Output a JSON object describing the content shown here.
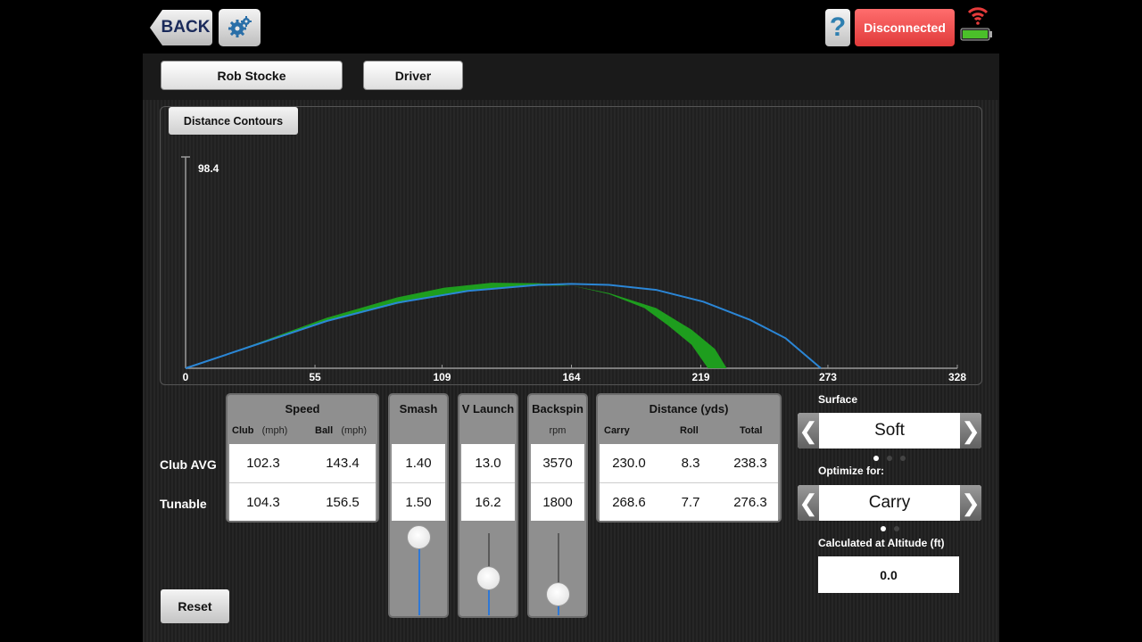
{
  "topbar": {
    "back_label": "BACK",
    "help_label": "?",
    "status_label": "Disconnected",
    "status_color": "#e84444"
  },
  "selectors": {
    "player": "Rob Stocke",
    "club": "Driver"
  },
  "chart": {
    "toggle_label": "Distance Contours",
    "y_max_label": "98.4"
  },
  "chart_data": {
    "type": "line",
    "title": "",
    "xlabel": "",
    "ylabel": "",
    "x_ticks": [
      "0",
      "55",
      "109",
      "164",
      "219",
      "273",
      "328"
    ],
    "xlim": [
      0,
      328
    ],
    "ylim": [
      0,
      98.4
    ],
    "series": [
      {
        "color": "#2b86d6",
        "points": [
          [
            0,
            0
          ],
          [
            30,
            11
          ],
          [
            60,
            22
          ],
          [
            90,
            30.5
          ],
          [
            120,
            36
          ],
          [
            150,
            38.8
          ],
          [
            164,
            39.3
          ],
          [
            180,
            38.8
          ],
          [
            200,
            36.5
          ],
          [
            220,
            31
          ],
          [
            240,
            22.5
          ],
          [
            255,
            14
          ],
          [
            270,
            0
          ]
        ]
      },
      {
        "color": "#1e9d1e",
        "fill": true,
        "upper": [
          [
            0,
            0
          ],
          [
            30,
            11.5
          ],
          [
            60,
            23.5
          ],
          [
            90,
            33
          ],
          [
            110,
            37.5
          ],
          [
            130,
            39.8
          ],
          [
            150,
            39.6
          ],
          [
            164,
            38.5
          ],
          [
            180,
            35
          ],
          [
            200,
            28
          ],
          [
            215,
            18
          ],
          [
            225,
            9
          ],
          [
            230,
            0
          ]
        ],
        "lower": [
          [
            0,
            0
          ],
          [
            30,
            10.8
          ],
          [
            60,
            21.7
          ],
          [
            90,
            30
          ],
          [
            110,
            34.5
          ],
          [
            130,
            37.3
          ],
          [
            150,
            38.4
          ],
          [
            164,
            38.5
          ],
          [
            180,
            34.5
          ],
          [
            195,
            28
          ],
          [
            205,
            20
          ],
          [
            215,
            11
          ],
          [
            222,
            0
          ]
        ]
      }
    ]
  },
  "table": {
    "row_labels": [
      "Club AVG",
      "Tunable"
    ],
    "speed": {
      "header": "Speed",
      "club_label": "Club",
      "ball_label": "Ball",
      "unit": "(mph)",
      "rows": [
        [
          "102.3",
          "143.4"
        ],
        [
          "104.3",
          "156.5"
        ]
      ]
    },
    "smash": {
      "header": "Smash",
      "rows": [
        "1.40",
        "1.50"
      ],
      "slider_fraction": 0.95
    },
    "vlaunch": {
      "header": "V Launch",
      "rows": [
        "13.0",
        "16.2"
      ],
      "slider_fraction": 0.45
    },
    "backspin": {
      "header": "Backspin",
      "unit": "rpm",
      "rows": [
        "3570",
        "1800"
      ],
      "slider_fraction": 0.25
    },
    "distance": {
      "header": "Distance (yds)",
      "columns": [
        "Carry",
        "Roll",
        "Total"
      ],
      "rows": [
        [
          "230.0",
          "8.3",
          "238.3"
        ],
        [
          "268.6",
          "7.7",
          "276.3"
        ]
      ]
    }
  },
  "reset_label": "Reset",
  "surface": {
    "label": "Surface",
    "value": "Soft",
    "pages": 3,
    "active": 0
  },
  "optimize": {
    "label": "Optimize for:",
    "value": "Carry",
    "pages": 2,
    "active": 0
  },
  "altitude": {
    "label": "Calculated at Altitude (ft)",
    "value": "0.0"
  }
}
